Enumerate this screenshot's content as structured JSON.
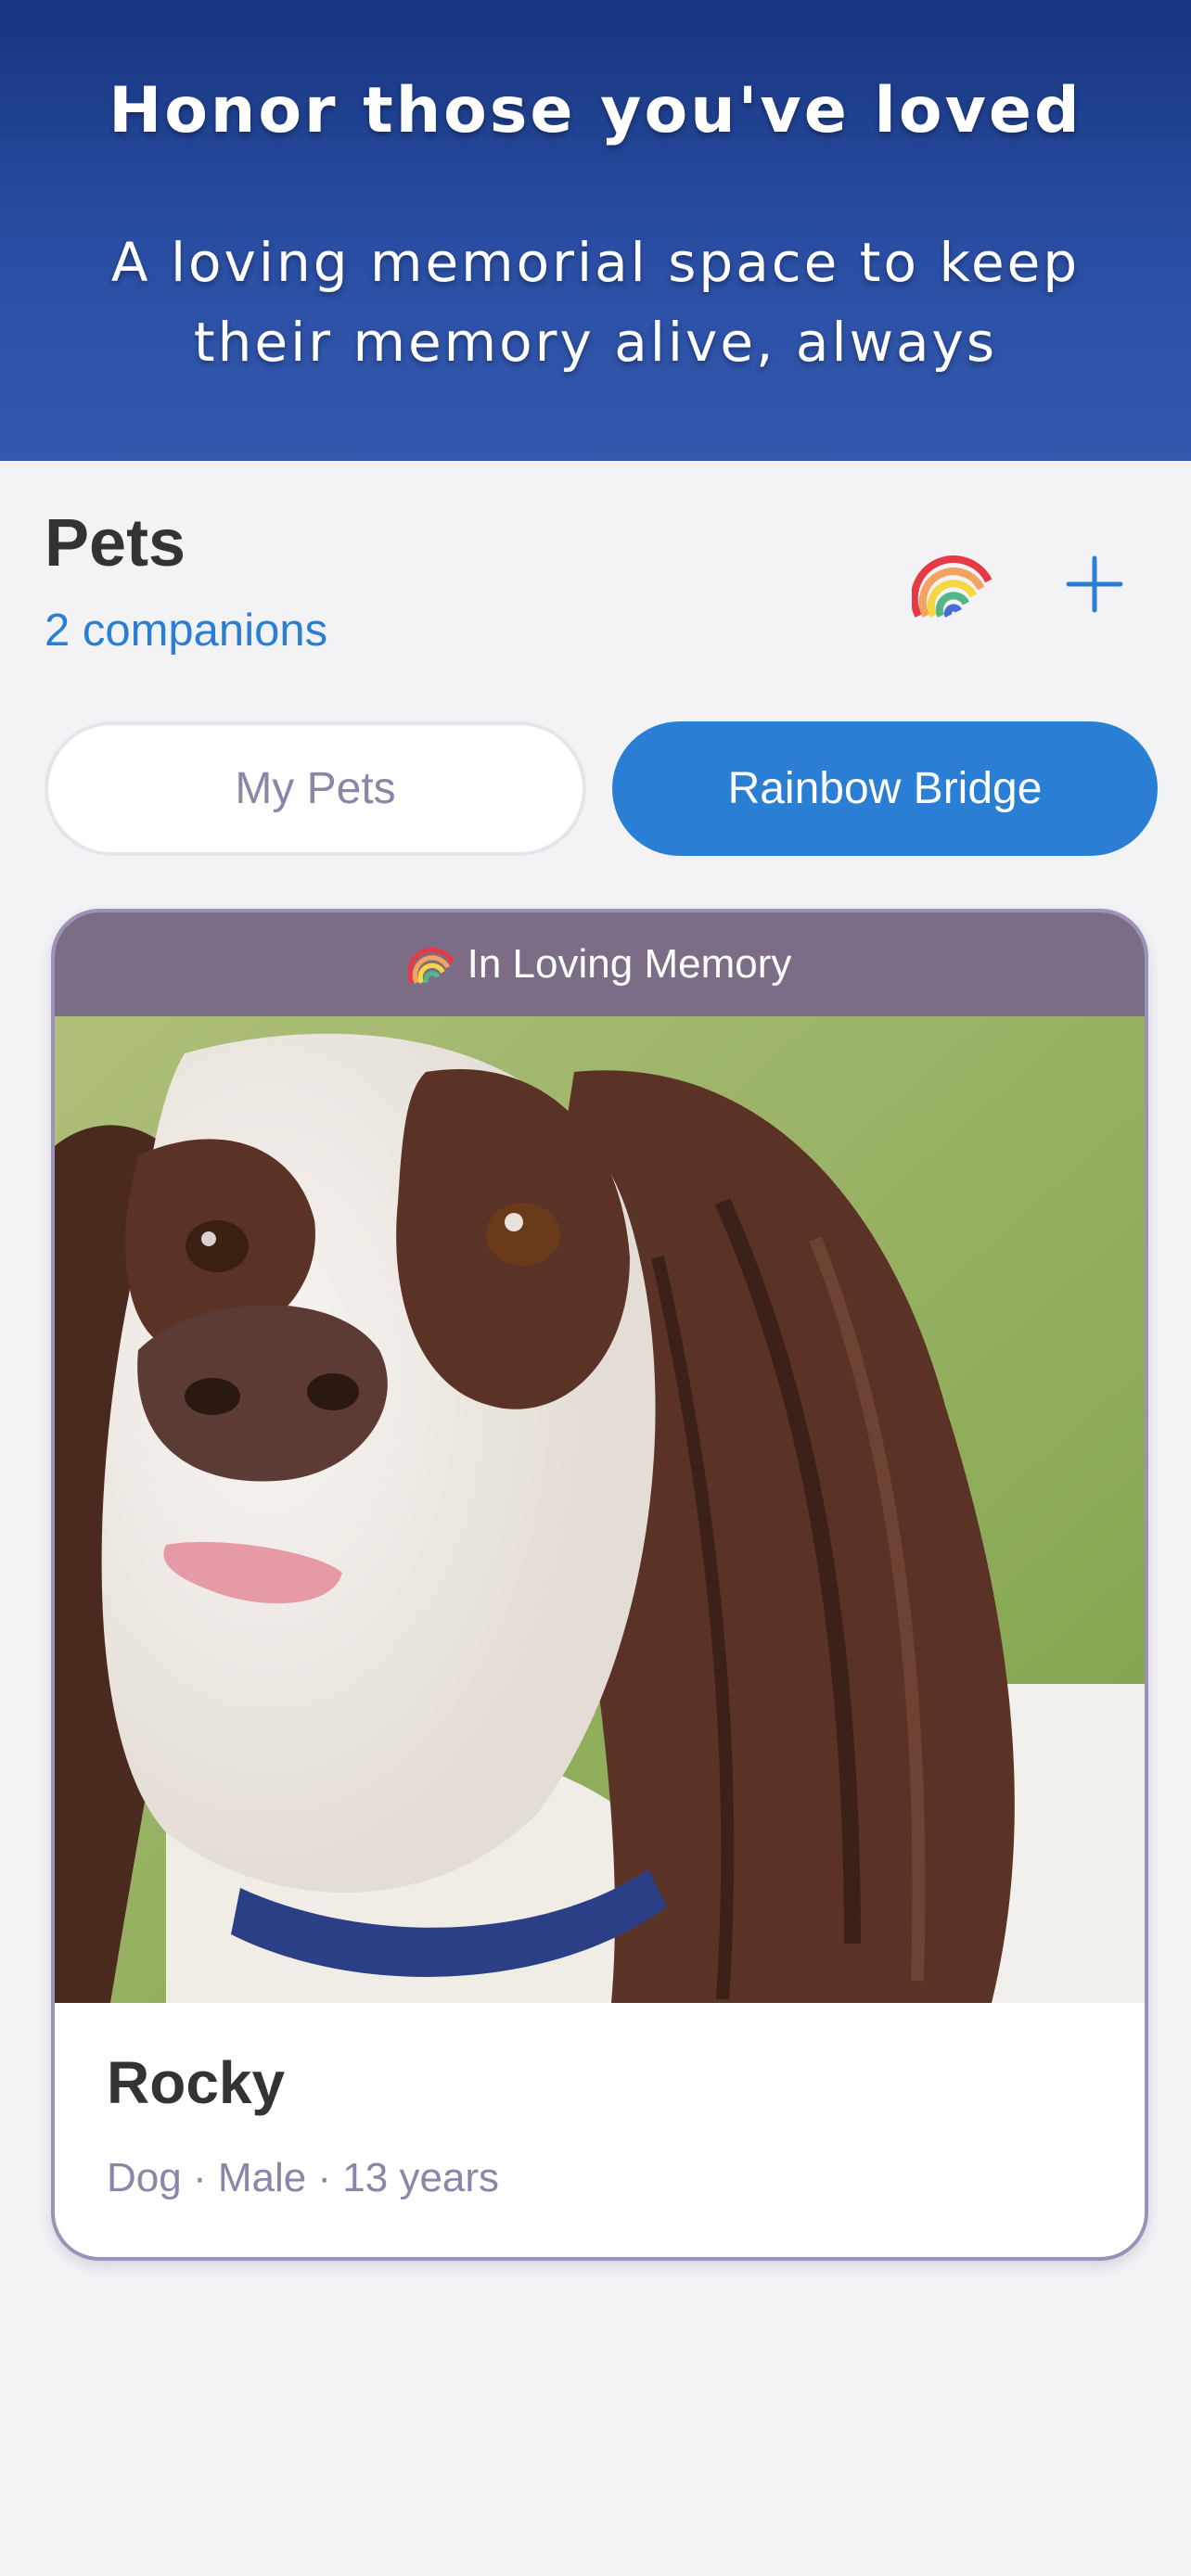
{
  "hero": {
    "title": "Honor those you've loved",
    "subtitle": "A loving memorial space to keep their memory alive, always"
  },
  "header": {
    "title": "Pets",
    "count_label": "2 companions",
    "rainbow_icon": "rainbow-icon",
    "add_icon": "plus-icon"
  },
  "tabs": [
    {
      "label": "My Pets",
      "selected": false
    },
    {
      "label": "Rainbow Bridge",
      "selected": true
    }
  ],
  "card": {
    "banner": "In Loving Memory",
    "name": "Rocky",
    "meta": "Dog · Male · 13 years"
  },
  "colors": {
    "accent": "#2a7fd4",
    "hero_top": "#17357f",
    "hero_bottom": "#3358ad",
    "card_border": "#9c91b7",
    "memory_band": "#7b6d86",
    "muted_text": "#8a86a8"
  }
}
